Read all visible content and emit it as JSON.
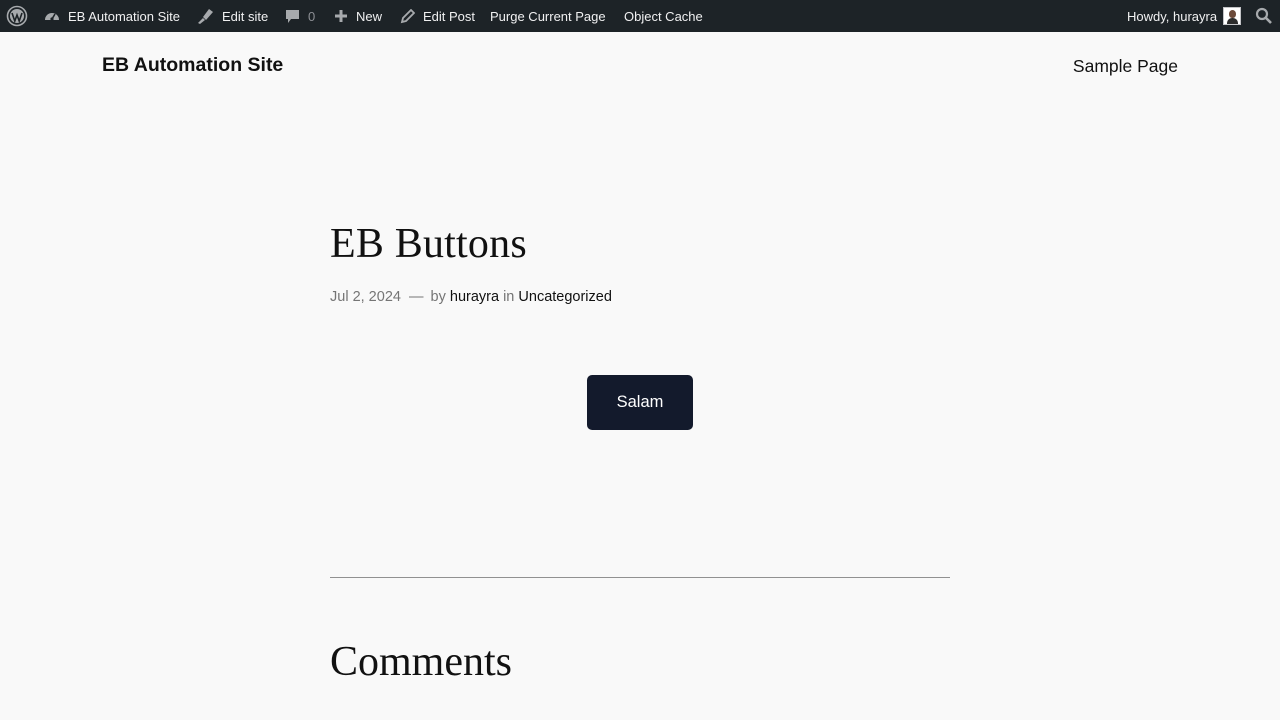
{
  "adminbar": {
    "site_name": "EB Automation Site",
    "edit_site": "Edit site",
    "comments_count": "0",
    "new_label": "New",
    "edit_post": "Edit Post",
    "purge_label": "Purge Current Page",
    "object_cache": "Object Cache",
    "howdy": "Howdy, hurayra",
    "icons": [
      "wordpress-logo-icon",
      "dashboard-icon",
      "brush-icon",
      "comment-icon",
      "plus-icon",
      "pencil-icon",
      "search-icon"
    ]
  },
  "header": {
    "site_title": "EB Automation Site",
    "nav_item": "Sample Page"
  },
  "post": {
    "title": "EB Buttons",
    "date": "Jul 2, 2024",
    "dash": "—",
    "by": "by",
    "author": "hurayra",
    "in": "in",
    "category": "Uncategorized",
    "button_label": "Salam"
  },
  "comments": {
    "heading": "Comments"
  },
  "colors": {
    "adminbar_bg": "#1d2327",
    "page_bg": "#f9f9f9",
    "button_bg": "#131a2c"
  }
}
